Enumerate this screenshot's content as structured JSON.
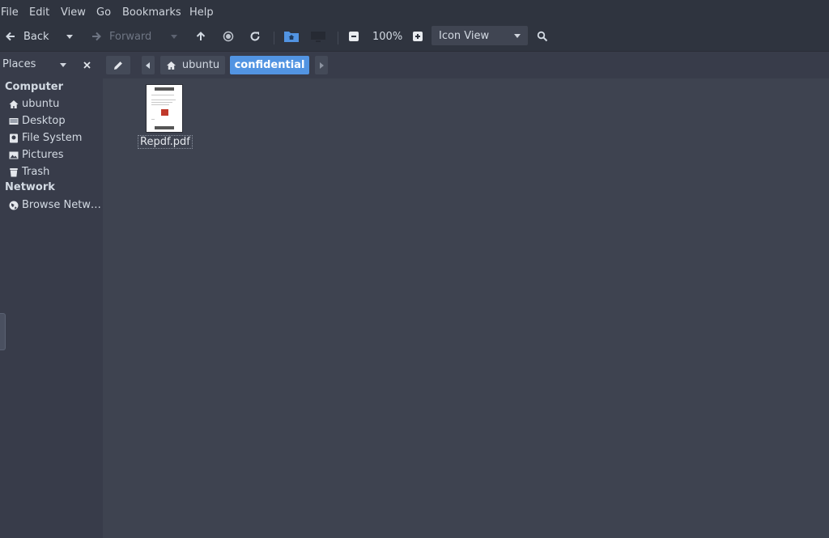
{
  "menu": [
    "File",
    "Edit",
    "View",
    "Go",
    "Bookmarks",
    "Help"
  ],
  "toolbar": {
    "back_label": "Back",
    "forward_label": "Forward",
    "zoom_level": "100%",
    "view_mode": "Icon View"
  },
  "sidebar": {
    "header": "Places",
    "sections": [
      {
        "title": "Computer",
        "items": [
          {
            "label": "ubuntu",
            "icon": "home-icon"
          },
          {
            "label": "Desktop",
            "icon": "desktop-icon"
          },
          {
            "label": "File System",
            "icon": "drive-icon"
          },
          {
            "label": "Pictures",
            "icon": "pictures-icon"
          },
          {
            "label": "Trash",
            "icon": "trash-icon"
          }
        ]
      },
      {
        "title": "Network",
        "items": [
          {
            "label": "Browse Netw…",
            "icon": "network-icon"
          }
        ]
      }
    ]
  },
  "pathbar": {
    "crumbs": [
      {
        "label": "ubuntu",
        "icon": "home-icon"
      },
      {
        "label": "confidential",
        "active": true
      }
    ]
  },
  "files": [
    {
      "name": "Repdf.pdf",
      "type": "pdf"
    }
  ],
  "colors": {
    "accent": "#5294e2",
    "background": "#3e4350",
    "sidebar": "#383c4a",
    "toolbar": "#2f343f"
  }
}
